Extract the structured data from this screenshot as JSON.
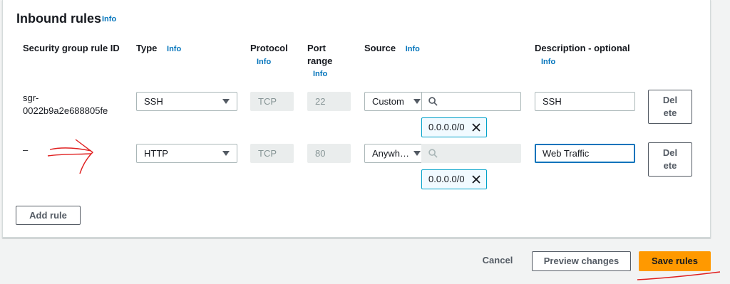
{
  "panel": {
    "title": "Inbound rules",
    "title_info": "Info"
  },
  "columns": {
    "rule_id": "Security group rule ID",
    "type": "Type",
    "type_info": "Info",
    "protocol": "Protocol",
    "protocol_info": "Info",
    "port_line1": "Port",
    "port_line2": "range",
    "port_info": "Info",
    "source": "Source",
    "source_info": "Info",
    "description": "Description - optional",
    "description_info": "Info"
  },
  "rules": [
    {
      "id_line1": "sgr-",
      "id_line2": "0022b9a2e688805fe",
      "type": "SSH",
      "protocol": "TCP",
      "port": "22",
      "source": "Custom",
      "cidr": "0.0.0.0/0",
      "description": "SSH",
      "delete_line1": "Del",
      "delete_line2": "ete"
    },
    {
      "id_line1": "–",
      "type": "HTTP",
      "protocol": "TCP",
      "port": "80",
      "source": "Anywh…",
      "cidr": "0.0.0.0/0",
      "description": "Web Traffic",
      "delete_line1": "Del",
      "delete_line2": "ete"
    }
  ],
  "buttons": {
    "add_rule": "Add rule",
    "cancel": "Cancel",
    "preview": "Preview changes",
    "save": "Save rules"
  },
  "colors": {
    "primary": "#ff9900",
    "link": "#0073bb",
    "annotation": "#e02020"
  }
}
